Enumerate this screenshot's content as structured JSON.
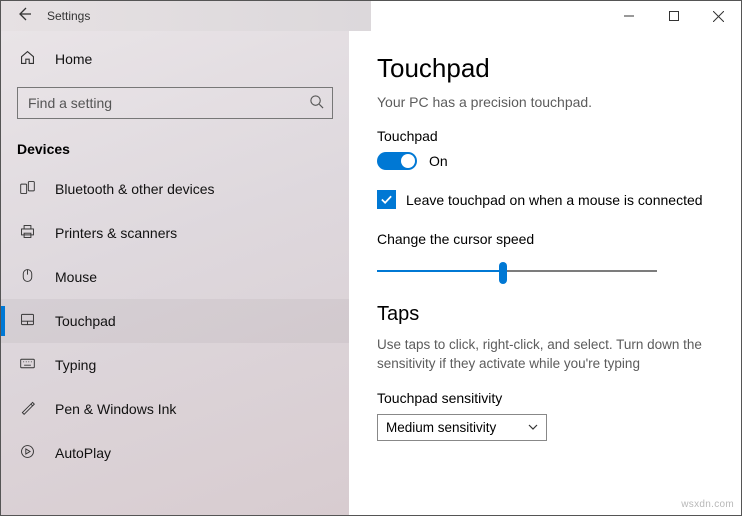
{
  "titlebar": {
    "title": "Settings"
  },
  "sidebar": {
    "home": "Home",
    "search_placeholder": "Find a setting",
    "section": "Devices",
    "items": [
      {
        "label": "Bluetooth & other devices"
      },
      {
        "label": "Printers & scanners"
      },
      {
        "label": "Mouse"
      },
      {
        "label": "Touchpad"
      },
      {
        "label": "Typing"
      },
      {
        "label": "Pen & Windows Ink"
      },
      {
        "label": "AutoPlay"
      }
    ]
  },
  "content": {
    "title": "Touchpad",
    "subtitle": "Your PC has a precision touchpad.",
    "toggle_group": "Touchpad",
    "toggle_state": "On",
    "checkbox_label": "Leave touchpad on when a mouse is connected",
    "slider_label": "Change the cursor speed",
    "taps_heading": "Taps",
    "taps_desc": "Use taps to click, right-click, and select. Turn down the sensitivity if they activate while you're typing",
    "sensitivity_label": "Touchpad sensitivity",
    "sensitivity_value": "Medium sensitivity"
  },
  "watermark": "wsxdn.com"
}
